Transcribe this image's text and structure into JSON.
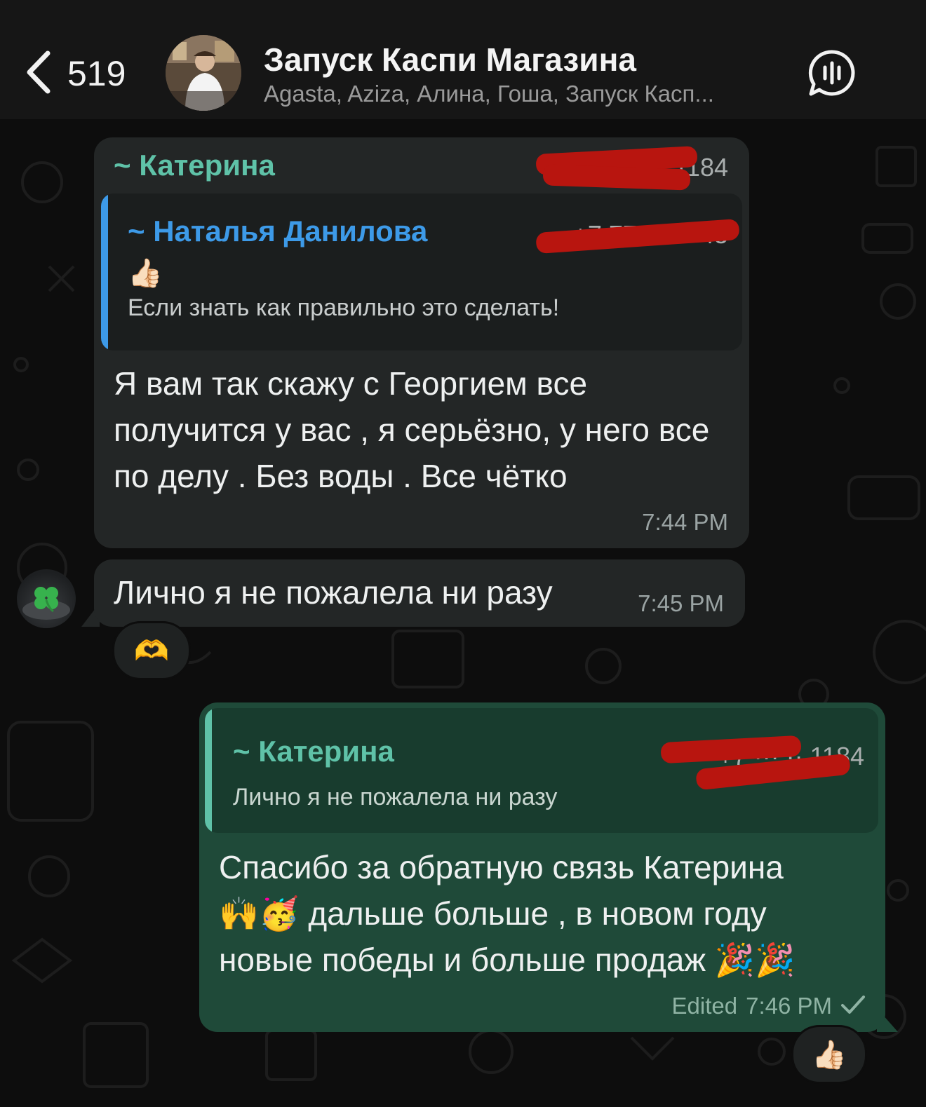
{
  "header": {
    "back_count": "519",
    "group_title": "Запуск Каспи Магазина",
    "members": "Agasta, Aziza, Алина, Гоша, Запуск Касп..."
  },
  "messages": [
    {
      "sender": "~ Катерина",
      "phone": "+7 ··· ·· 1184",
      "quote": {
        "sender": "~ Наталья Данилова",
        "phone": "+7 77 ··· ·· 45",
        "emoji": "👍🏻",
        "text": "Если знать как правильно это сделать!"
      },
      "text": "Я вам так скажу с Георгием  все получится у вас , я серьёзно,  у него все по  делу  . Без воды . Все чётко",
      "time": "7:44 PM"
    },
    {
      "text": "Лично я не пожалела ни разу",
      "time": "7:45 PM",
      "reaction": "🫶"
    },
    {
      "quote": {
        "sender": "~ Катерина",
        "phone": "+7 ··· ·· 1184",
        "text": "Лично я не пожалела ни разу"
      },
      "text_line1": "Спасибо за обратную связь Катерина",
      "text_line2": "🙌🥳 дальше больше , в новом году",
      "text_line3": "новые победы и больше продаж 🎉🎉",
      "edited": "Edited",
      "time": "7:46 PM",
      "status_icon": "single-check-icon",
      "reaction": "👍🏻"
    }
  ],
  "colors": {
    "incoming_bubble": "#232626",
    "outgoing_bubble": "#1f4a39",
    "sender_teal": "#5fc2a8",
    "sender_blue": "#3d9ae8",
    "redaction": "#b8150f"
  }
}
